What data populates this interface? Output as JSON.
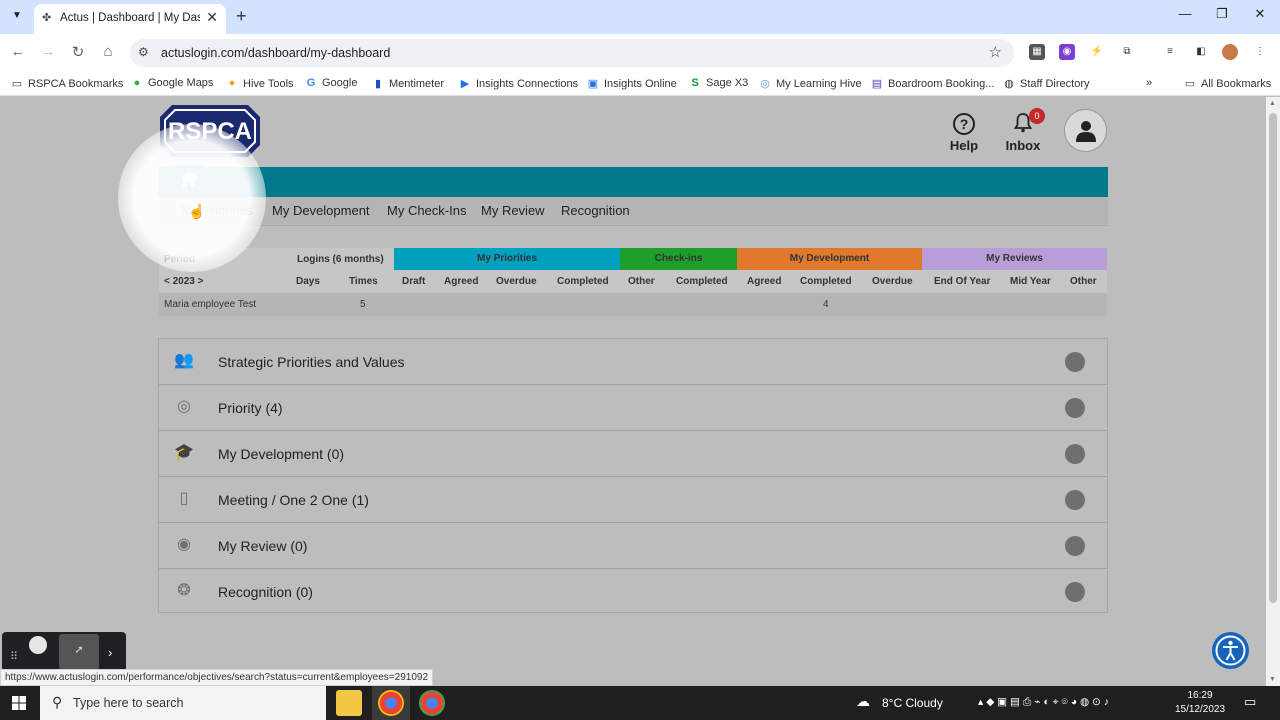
{
  "browser": {
    "tab_title": "Actus | Dashboard | My Dashbo",
    "url": "actuslogin.com/dashboard/my-dashboard",
    "status_url": "https://www.actuslogin.com/performance/objectives/search?status=current&employees=291092"
  },
  "bookmarks": [
    {
      "label": "RSPCA Bookmarks",
      "icon": "folder-icon"
    },
    {
      "label": "Google Maps",
      "icon": "maps-pin-icon"
    },
    {
      "label": "Hive Tools",
      "icon": "hive-icon"
    },
    {
      "label": "Google",
      "icon": "google-icon"
    },
    {
      "label": "Mentimeter",
      "icon": "mentimeter-icon"
    },
    {
      "label": "Insights Connections",
      "icon": "insights-icon"
    },
    {
      "label": "Insights Online",
      "icon": "insights-online-icon"
    },
    {
      "label": "Sage X3",
      "icon": "sage-icon"
    },
    {
      "label": "My Learning Hive",
      "icon": "learning-icon"
    },
    {
      "label": "Boardroom Booking...",
      "icon": "booking-icon"
    },
    {
      "label": "Staff Directory",
      "icon": "globe-icon"
    }
  ],
  "bookmarks_more": "»",
  "all_bookmarks": "All Bookmarks",
  "header": {
    "logo_text": "RSPCA",
    "help_label": "Help",
    "inbox_label": "Inbox",
    "inbox_count": "0"
  },
  "subnav": [
    "My Priorities",
    "My Development",
    "My Check-Ins",
    "My Review",
    "Recognition"
  ],
  "stats": {
    "period_label": "Period",
    "logins_label": "Logins (6 months)",
    "year_label": "< 2023 >",
    "groups": [
      {
        "label": "My Priorities",
        "color": "#00a0bf"
      },
      {
        "label": "Check-ins",
        "color": "#1e9e2a"
      },
      {
        "label": "My Development",
        "color": "#e0792c"
      },
      {
        "label": "My Reviews",
        "color": "#b89ed8"
      }
    ],
    "columns": [
      "Days",
      "Times",
      "Draft",
      "Agreed",
      "Overdue",
      "Completed",
      "Other",
      "Completed",
      "Agreed",
      "Completed",
      "Overdue",
      "End Of Year",
      "Mid Year",
      "Other"
    ],
    "row": {
      "name": "Maria employee Test",
      "times": "5",
      "dev_completed": "4"
    }
  },
  "sections": [
    {
      "title": "Strategic Priorities and Values",
      "icon": "people-icon"
    },
    {
      "title": "Priority (4)",
      "icon": "target-icon"
    },
    {
      "title": "My Development (0)",
      "icon": "graduation-cap-icon"
    },
    {
      "title": "Meeting / One 2 One (1)",
      "icon": "meeting-icon"
    },
    {
      "title": "My Review (0)",
      "icon": "review-icon"
    },
    {
      "title": "Recognition (0)",
      "icon": "recognition-icon"
    }
  ],
  "taskbar": {
    "search_placeholder": "Type here to search",
    "weather": "8°C  Cloudy",
    "time": "16:29",
    "date": "15/12/2023"
  }
}
